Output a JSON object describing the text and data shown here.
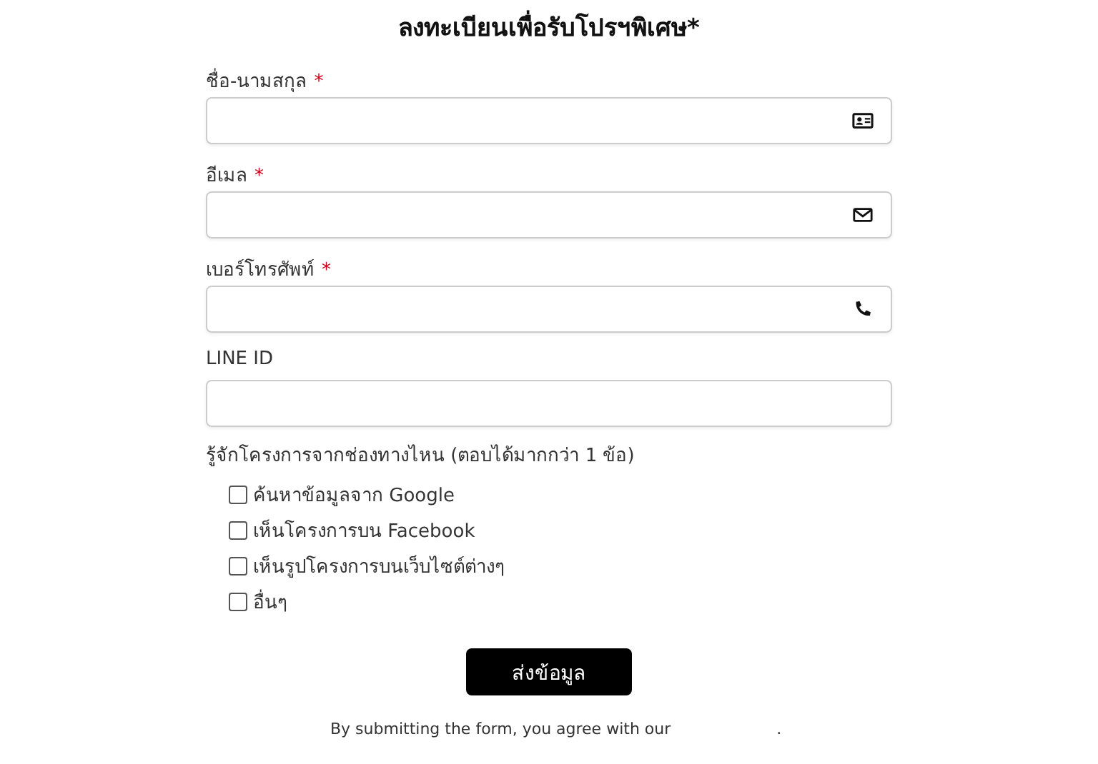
{
  "form": {
    "title": "ลงทะเบียนเพื่อรับโปรฯพิเศษ*",
    "fields": [
      {
        "label": "ชื่อ-นามสกุล",
        "required_mark": "*",
        "kind": "name"
      },
      {
        "label": "อีเมล",
        "required_mark": "*",
        "kind": "email"
      },
      {
        "label": "เบอร์โทรศัพท์",
        "required_mark": "*",
        "kind": "phone"
      },
      {
        "label": "LINE ID",
        "kind": "text"
      }
    ],
    "question": "รู้จักโครงการจากช่องทางไหน (ตอบได้มากกว่า 1 ข้อ)",
    "options": [
      {
        "label": "ค้นหาข้อมูลจาก Google",
        "checked": false
      },
      {
        "label": "เห็นโครงการบน Facebook",
        "checked": false
      },
      {
        "label": "เห็นรูปโครงการบนเว็บไซต์ต่างๆ",
        "checked": false
      },
      {
        "label": "อื่นๆ",
        "checked": false
      }
    ],
    "submit": "ส่งข้อมูล",
    "footer": {
      "text": "By submitting the form, you agree with our",
      "end": "."
    }
  }
}
